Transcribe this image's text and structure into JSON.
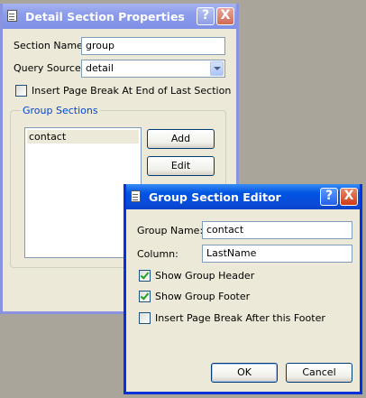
{
  "detail_dialog": {
    "title": "Detail Section Properties",
    "help_label": "?",
    "close_label": "X",
    "section_name_label": "Section Name:",
    "section_name_value": "group",
    "query_source_label": "Query Source:",
    "query_source_value": "detail",
    "page_break_label": "Insert Page Break At End of Last Section",
    "page_break_checked": false,
    "group_sections_label": "Group Sections",
    "group_list": [
      "contact"
    ],
    "add_label": "Add",
    "edit_label": "Edit"
  },
  "group_dialog": {
    "title": "Group Section Editor",
    "help_label": "?",
    "close_label": "X",
    "group_name_label": "Group Name:",
    "group_name_value": "contact",
    "column_label": "Column:",
    "column_value": "LastName",
    "show_header_label": "Show Group Header",
    "show_header_checked": true,
    "show_footer_label": "Show Group Footer",
    "show_footer_checked": true,
    "page_break_label": "Insert Page Break After this Footer",
    "page_break_checked": false,
    "ok_label": "OK",
    "cancel_label": "Cancel"
  }
}
